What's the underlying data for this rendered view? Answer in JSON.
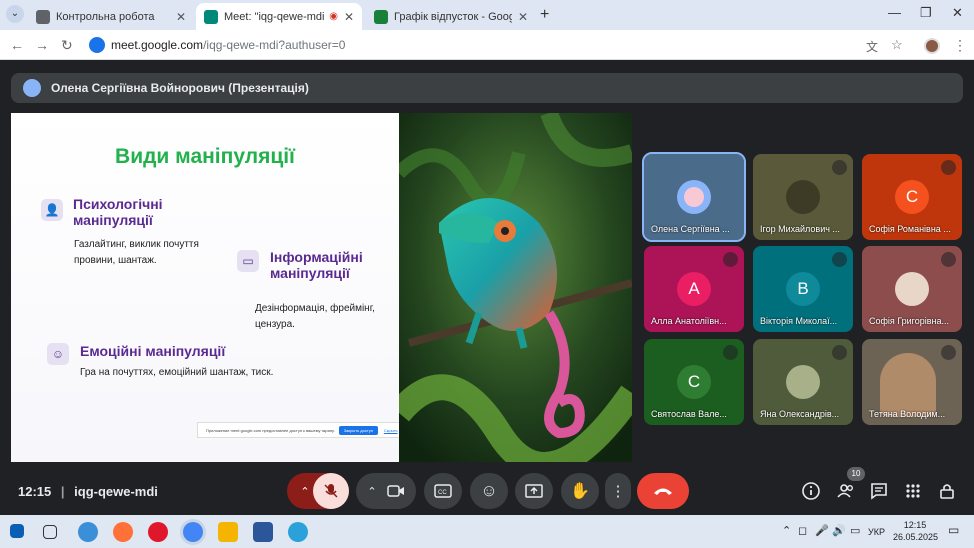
{
  "browser": {
    "tabs": [
      {
        "title": "Контрольна робота",
        "active": false,
        "favicon_color": "#5f6368"
      },
      {
        "title": "Meet: \"iqg-qewe-mdi\"",
        "active": true,
        "favicon_color": "#00897b"
      },
      {
        "title": "Графік відпусток - Google Таб",
        "active": false,
        "favicon_color": "#188038"
      }
    ],
    "url_host": "meet.google.com",
    "url_path": "/iqg-qewe-mdi?authuser=0"
  },
  "meet": {
    "presenter_banner": "Олена Сергіївна Войнорович (Презентація)",
    "meeting_code": "iqg-qewe-mdi",
    "time": "12:15",
    "separator": "|",
    "participants_count": "10",
    "slide": {
      "title": "Види маніпуляції",
      "sections": [
        {
          "heading": "Психологічні маніпуляції",
          "text": "Газлайтинг, виклик почуття провини, шантаж."
        },
        {
          "heading": "Інформаційні маніпуляції",
          "text": "Дезінформація, фреймінг, цензура."
        },
        {
          "heading": "Емоційні маніпуляції",
          "text": "Гра на почуттях, емоційний шантаж, тиск."
        }
      ],
      "notice": {
        "text": "Приложение meet.google.com предоставлен доступ к вашему экрану.",
        "button": "Закрыть доступ",
        "link": "Скрыть"
      }
    },
    "tiles": [
      {
        "name": "Олена Сергіївна ...",
        "initial": "",
        "color": "#4a6b8a",
        "kind": "avatar-img",
        "muted": false
      },
      {
        "name": "Ігор Михайлович ...",
        "initial": "",
        "color": "#5a5a3a",
        "kind": "photo",
        "muted": true
      },
      {
        "name": "Софія Романівна ...",
        "initial": "С",
        "color": "#e8541c",
        "kind": "letter",
        "muted": true
      },
      {
        "name": "Алла Анатоліївн...",
        "initial": "А",
        "color": "#d81b60",
        "kind": "letter",
        "muted": true
      },
      {
        "name": "Вікторія Миколаї...",
        "initial": "В",
        "color": "#0e8a9b",
        "kind": "letter",
        "muted": true
      },
      {
        "name": "Софія Григорівна...",
        "initial": "",
        "color": "#8d4d4d",
        "kind": "photo",
        "muted": true
      },
      {
        "name": "Святослав Вале...",
        "initial": "С",
        "color": "#2e7d32",
        "kind": "letter",
        "muted": true
      },
      {
        "name": "Яна Олександрів...",
        "initial": "",
        "color": "#4f5b3a",
        "kind": "photo",
        "muted": true
      },
      {
        "name": "Тетяна Володим...",
        "initial": "",
        "color": "#6d6354",
        "kind": "video",
        "muted": true
      }
    ]
  },
  "taskbar": {
    "language": "УКР",
    "time": "12:15",
    "date": "26.05.2025"
  }
}
